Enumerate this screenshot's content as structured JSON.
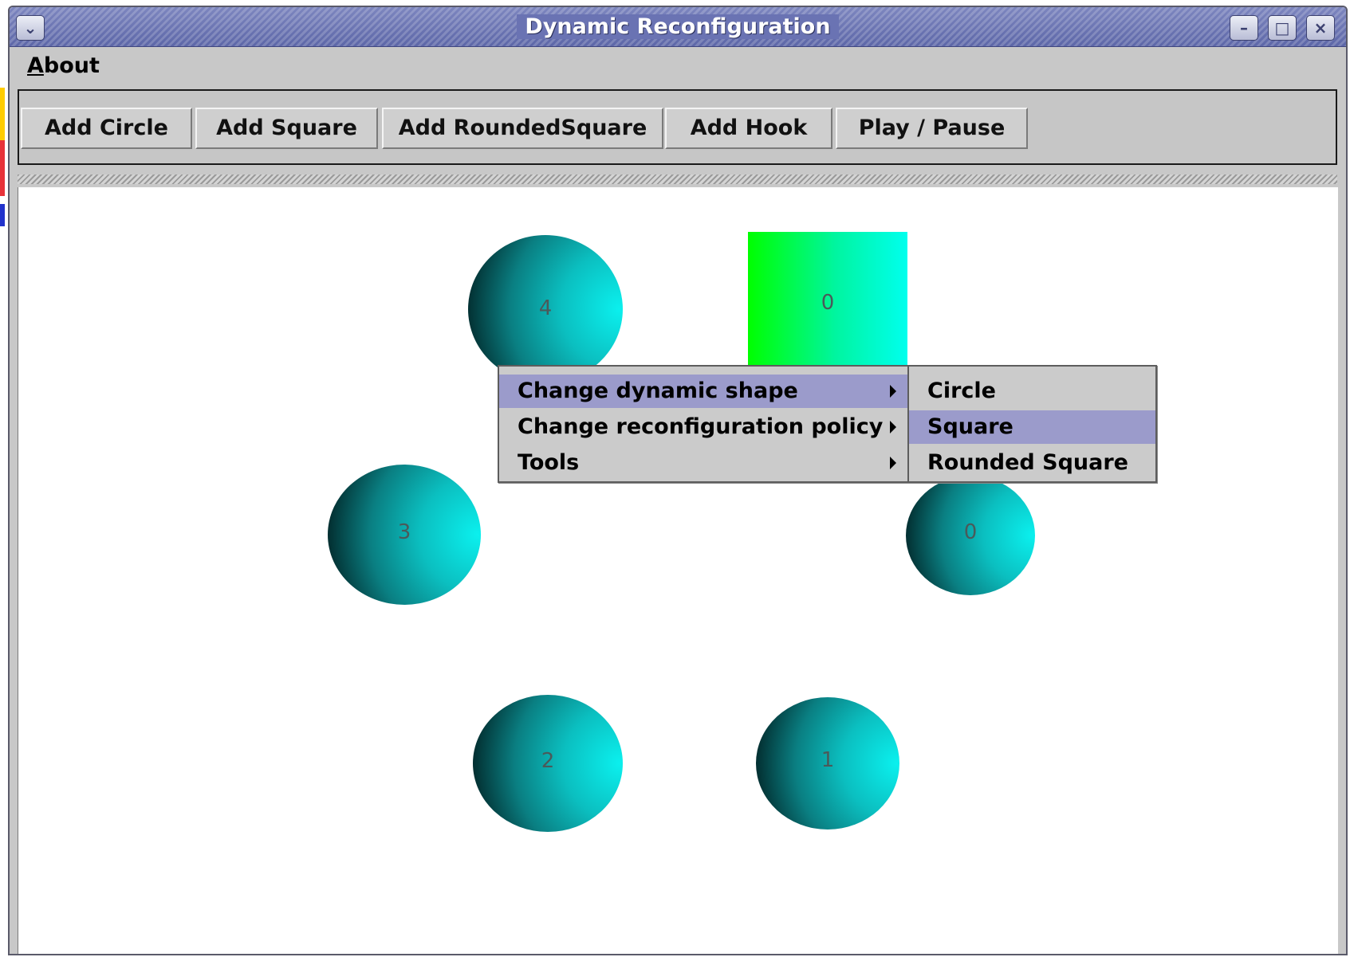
{
  "window": {
    "title": "Dynamic Reconfiguration"
  },
  "menubar": {
    "about_label_mnemonic": "A",
    "about_label_rest": "bout"
  },
  "toolbar": {
    "buttons": [
      {
        "label": "Add Circle"
      },
      {
        "label": "Add Square"
      },
      {
        "label": "Add RoundedSquare"
      },
      {
        "label": "Add Hook"
      },
      {
        "label": "Play / Pause"
      }
    ]
  },
  "canvas": {
    "circles": [
      {
        "label": "4"
      },
      {
        "label": "3"
      },
      {
        "label": "0"
      },
      {
        "label": "2"
      },
      {
        "label": "1"
      }
    ],
    "square": {
      "label": "0"
    }
  },
  "context_menu": {
    "items": [
      {
        "label": "Change dynamic shape",
        "selected": true
      },
      {
        "label": "Change reconfiguration policy",
        "selected": false
      },
      {
        "label": "Tools",
        "selected": false
      }
    ]
  },
  "submenu": {
    "items": [
      {
        "label": "Circle",
        "selected": false
      },
      {
        "label": "Square",
        "selected": true
      },
      {
        "label": "Rounded Square",
        "selected": false
      }
    ]
  },
  "colors": {
    "titlebar": "#6a73b3",
    "menu_selection": "#9b9bcb",
    "ball": "#0bbfc0",
    "square_left": "#00ff00",
    "square_right": "#00ffee"
  }
}
